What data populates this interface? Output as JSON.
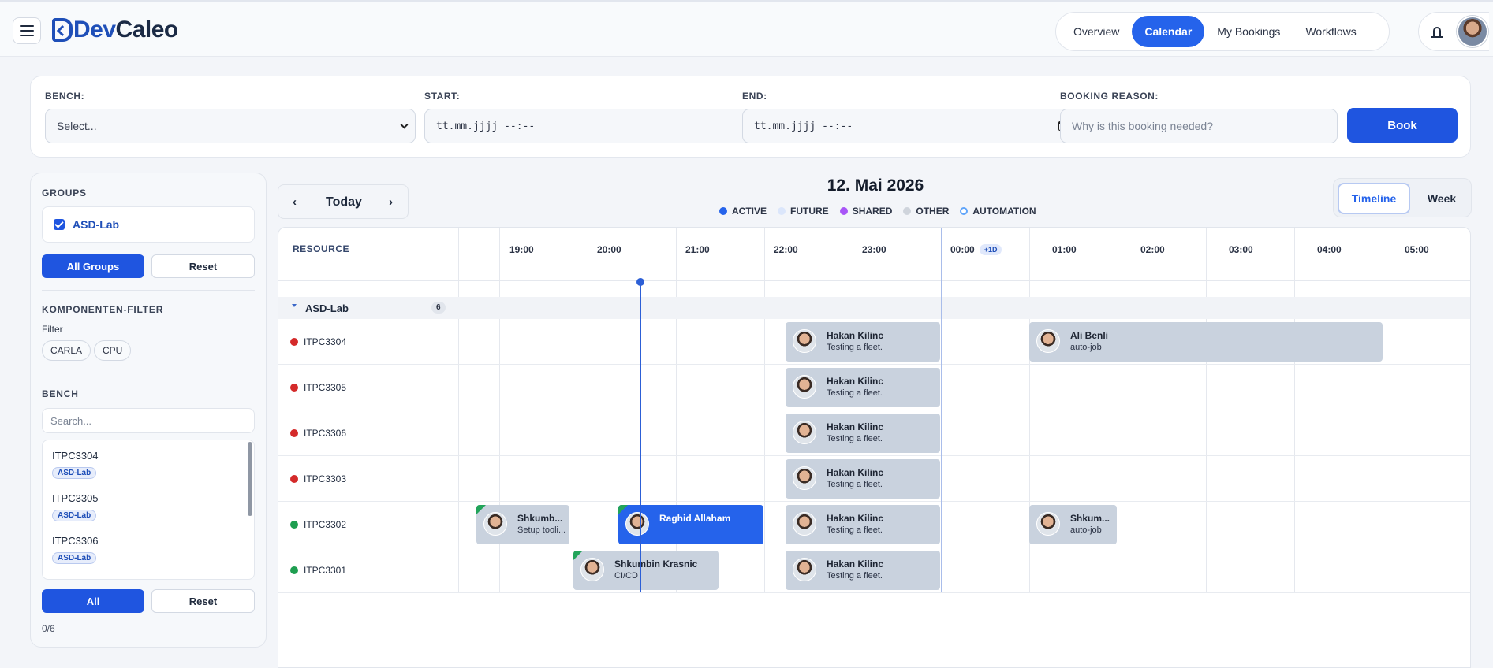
{
  "header": {
    "logo": {
      "dev": "Dev",
      "caleo": "Caleo"
    },
    "nav": [
      {
        "label": "Overview"
      },
      {
        "label": "Calendar",
        "active": true
      },
      {
        "label": "My Bookings"
      },
      {
        "label": "Workflows"
      }
    ]
  },
  "booking": {
    "bench_label": "BENCH:",
    "bench_value": "Select...",
    "start_label": "START:",
    "start_value": "tt.mm.jjjj --:--",
    "end_label": "END:",
    "end_value": "tt.mm.jjjj --:--",
    "reason_label": "BOOKING REASON:",
    "reason_placeholder": "Why is this booking needed?",
    "book_label": "Book"
  },
  "sidebar": {
    "groups_title": "GROUPS",
    "group_item": "ASD-Lab",
    "all_groups": "All Groups",
    "reset": "Reset",
    "filter_title": "KOMPONENTEN-FILTER",
    "filter_label": "Filter",
    "chips": [
      "CARLA",
      "CPU"
    ],
    "bench_title": "BENCH",
    "search_placeholder": "Search...",
    "bench_items": [
      {
        "name": "ITPC3304",
        "tag": "ASD-Lab"
      },
      {
        "name": "ITPC3305",
        "tag": "ASD-Lab"
      },
      {
        "name": "ITPC3306",
        "tag": "ASD-Lab"
      }
    ],
    "all": "All",
    "reset2": "Reset",
    "count": "0/6"
  },
  "calendar": {
    "today": "Today",
    "prev": "‹",
    "next": "›",
    "date": "12. Mai 2026",
    "legend": [
      {
        "label": "ACTIVE",
        "color": "#2563eb"
      },
      {
        "label": "FUTURE",
        "color": "#dbe6fb"
      },
      {
        "label": "SHARED",
        "color": "#a855f7"
      },
      {
        "label": "OTHER",
        "color": "#cfd4dc"
      },
      {
        "label": "AUTOMATION",
        "color": "#60a5fa"
      }
    ],
    "views": {
      "timeline": "Timeline",
      "week": "Week"
    },
    "resource_header": "RESOURCE",
    "hours": [
      "19:00",
      "20:00",
      "21:00",
      "22:00",
      "23:00",
      "00:00",
      "01:00",
      "02:00",
      "03:00",
      "04:00",
      "05:00"
    ],
    "plus_day": "+1D",
    "group": {
      "name": "ASD-Lab",
      "count": "6"
    },
    "resources": [
      {
        "name": "ITPC3304",
        "status": "#d42a2a"
      },
      {
        "name": "ITPC3305",
        "status": "#d42a2a"
      },
      {
        "name": "ITPC3306",
        "status": "#d42a2a"
      },
      {
        "name": "ITPC3303",
        "status": "#d42a2a"
      },
      {
        "name": "ITPC3302",
        "status": "#1e9e50"
      },
      {
        "name": "ITPC3301",
        "status": "#1e9e50"
      }
    ],
    "events": {
      "e1": {
        "name": "Hakan Kilinc",
        "desc": "Testing a fleet."
      },
      "e2": {
        "name": "Ali Benli",
        "desc": "auto-job"
      },
      "e3": {
        "name": "Hakan Kilinc",
        "desc": "Testing a fleet."
      },
      "e4": {
        "name": "Hakan Kilinc",
        "desc": "Testing a fleet."
      },
      "e5": {
        "name": "Hakan Kilinc",
        "desc": "Testing a fleet."
      },
      "e6": {
        "name": "Shkumb...",
        "desc": "Setup tooli..."
      },
      "e7": {
        "name": "Raghid Allaham",
        "desc": ""
      },
      "e8": {
        "name": "Hakan Kilinc",
        "desc": "Testing a fleet."
      },
      "e9": {
        "name": "Shkum...",
        "desc": "auto-job"
      },
      "e10": {
        "name": "Shkumbin Krasnic",
        "desc": "CI/CD"
      },
      "e11": {
        "name": "Hakan Kilinc",
        "desc": "Testing a fleet."
      }
    }
  }
}
